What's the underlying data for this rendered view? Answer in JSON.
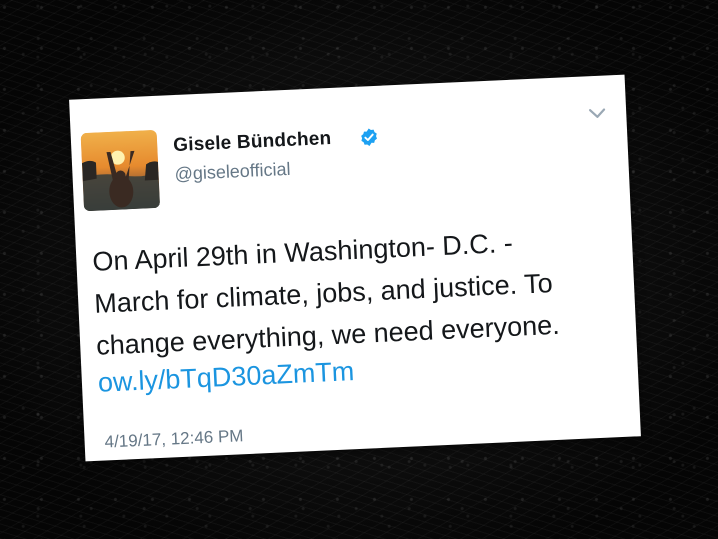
{
  "tweet": {
    "author": {
      "name": "Gisele Bündchen",
      "handle": "@giseleofficial",
      "verified": true,
      "avatar": "avatar-sunset-photo"
    },
    "text_lines": [
      "On April 29th in Washington- D.C. -",
      "March for climate, jobs, and justice. To",
      "change everything, we need everyone."
    ],
    "link": "ow.ly/bTqD30aZmTm",
    "timestamp": "4/19/17, 12:46 PM",
    "menu_icon": "chevron-down-icon"
  },
  "colors": {
    "background": "#0b0b0b",
    "card": "#ffffff",
    "text": "#14171a",
    "secondary_text": "#657786",
    "link": "#1b95e0",
    "verified": "#1da1f2"
  }
}
